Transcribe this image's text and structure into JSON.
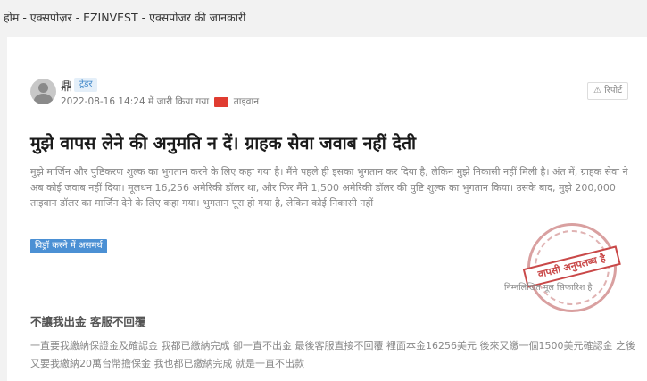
{
  "breadcrumb": "होम - एक्सपोज़र - EZINVEST - एक्सपोजर की जानकारी",
  "post": {
    "username": "鼎",
    "role": "ट्रेडर",
    "date": "2022-08-16 14:24",
    "issued_text": "में जारी किया गया",
    "location": "ताइवान",
    "report_label": "रिपोर्ट",
    "title": "मुझे वापस लेने की अनुमति न दें। ग्राहक सेवा जवाब नहीं देती",
    "body": "मुझे मार्जिन और पुष्टिकरण शुल्क का भुगतान करने के लिए कहा गया है। मैंने पहले ही इसका भुगतान कर दिया है, लेकिन मुझे निकासी नहीं मिली है। अंत में, ग्राहक सेवा ने अब कोई जवाब नहीं दिया। मूलधन 16,256 अमेरिकी डॉलर था, और फिर मैंने 1,500 अमेरिकी डॉलर की पुष्टि शुल्क का भुगतान किया। उसके बाद, मुझे 200,000 ताइवान डॉलर का मार्जिन देने के लिए कहा गया। भुगतान पूरा हो गया है, लेकिन कोई निकासी नहीं",
    "status_badge": "विड्रॉ करने में असमर्थ",
    "stamp_text": "वापसी अनुपलब्ध है",
    "recommend_text": "निम्नलिखित मूल सिफारिश है"
  },
  "original": {
    "title": "不讓我出金 客服不回覆",
    "body": "一直要我繳納保證金及確認金 我都已繳納完成 卻一直不出金 最後客服直接不回覆 裡面本金16256美元 後來又繳一個1500美元確認金 之後又要我繳納20萬台幣擔保金 我也都已繳納完成 就是一直不出款"
  },
  "colors": {
    "accent": "#4b90d4",
    "stamp": "#c94848",
    "page_bg": "#f2f2f2"
  }
}
